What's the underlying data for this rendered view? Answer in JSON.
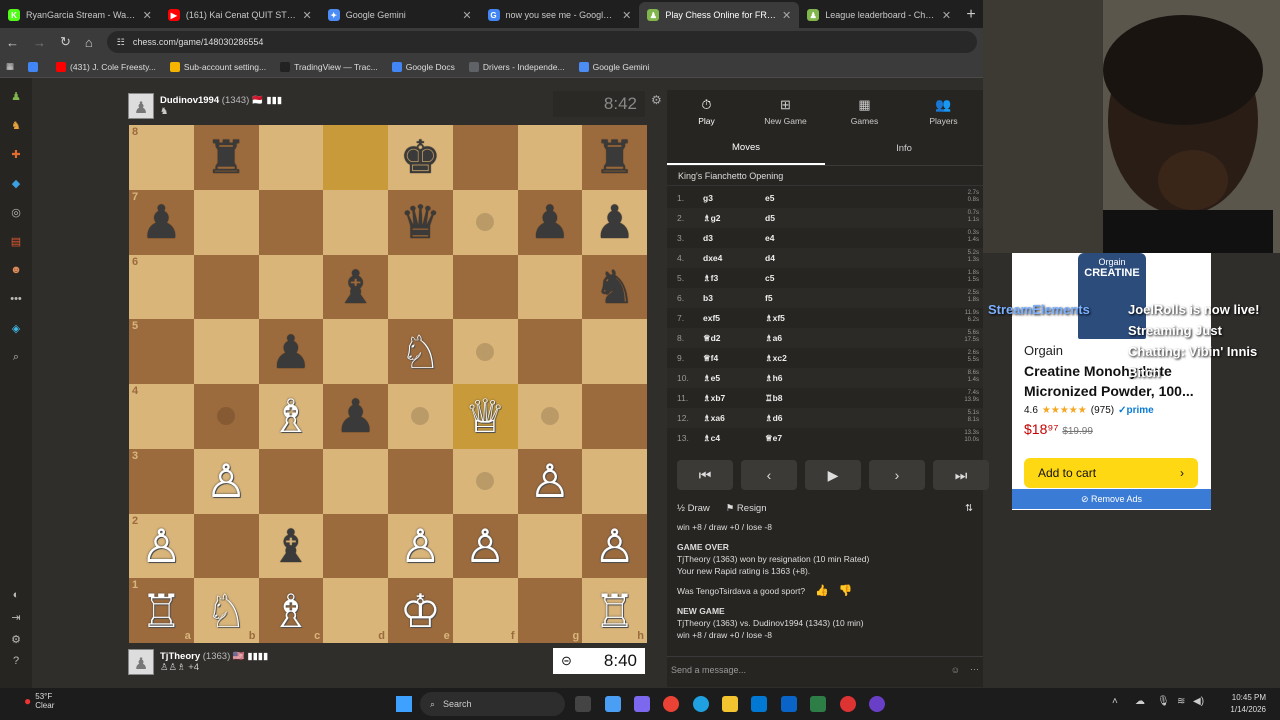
{
  "browser": {
    "tabs": [
      {
        "title": "RyanGarcia Stream - Watch Live",
        "color": "#53fc18",
        "glyph": "K"
      },
      {
        "title": "(161) Kai Cenat QUIT STREAMING",
        "color": "#ff0000",
        "glyph": "▶"
      },
      {
        "title": "Google Gemini",
        "color": "#4b8cf5",
        "glyph": "✦"
      },
      {
        "title": "now you see me - Google Search",
        "color": "#4285f4",
        "glyph": "G"
      },
      {
        "title": "Play Chess Online for FREE - 2 P",
        "color": "#81b64c",
        "glyph": "♟",
        "active": true
      },
      {
        "title": "League leaderboard - Chess.com",
        "color": "#81b64c",
        "glyph": "♟"
      }
    ],
    "url": "chess.com/game/148030286554",
    "bookmarks": [
      {
        "label": "",
        "color": "#4285f4"
      },
      {
        "label": "(431) J. Cole Freesty...",
        "color": "#ff0000"
      },
      {
        "label": "Sub-account setting...",
        "color": "#f4b400"
      },
      {
        "label": "TradingView — Trac...",
        "color": "#222222"
      },
      {
        "label": "Google Docs",
        "color": "#4285f4"
      },
      {
        "label": "Drivers - Independe...",
        "color": "#5f6368"
      },
      {
        "label": "Google Gemini",
        "color": "#4b8cf5"
      }
    ]
  },
  "game": {
    "top_player": {
      "name": "Dudinov1994",
      "rating": "(1343)",
      "flag": "🇲🇨 ▮▮▮",
      "clock": "8:42"
    },
    "bottom_player": {
      "name": "TjTheory",
      "rating": "(1363)",
      "flag": "🇺🇸 ▮▮▮▮",
      "captured": "♙♙♗ +4",
      "clock": "8:40"
    },
    "board": [
      [
        "",
        "♜",
        "",
        "",
        "♚",
        "",
        "",
        "♜"
      ],
      [
        "♟",
        "",
        "",
        "",
        "♛",
        "",
        "♟",
        "♟"
      ],
      [
        "",
        "",
        "",
        "♝",
        "",
        "",
        "",
        "♞"
      ],
      [
        "",
        "",
        "♟",
        "",
        "♘",
        "",
        "",
        ""
      ],
      [
        "",
        "",
        "♗",
        "♟",
        "",
        "♕",
        "",
        ""
      ],
      [
        "",
        "♙",
        "",
        "",
        "",
        "",
        "♙",
        ""
      ],
      [
        "♙",
        "",
        "♝",
        "",
        "♙",
        "♙",
        "",
        "♙"
      ],
      [
        "♖",
        "♘",
        "♗",
        "",
        "♔",
        "",
        "",
        "♖"
      ]
    ],
    "ranks": [
      "8",
      "7",
      "6",
      "5",
      "4",
      "3",
      "2",
      "1"
    ],
    "files": [
      "a",
      "b",
      "c",
      "d",
      "e",
      "f",
      "g",
      "h"
    ]
  },
  "panel": {
    "tabs": [
      {
        "label": "Play",
        "icon": "⏱"
      },
      {
        "label": "New Game",
        "icon": "⊞"
      },
      {
        "label": "Games",
        "icon": "▦"
      },
      {
        "label": "Players",
        "icon": "👥"
      }
    ],
    "subtabs": [
      "Moves",
      "Info"
    ],
    "opening": "King's Fianchetto Opening",
    "moves": [
      {
        "n": "1.",
        "w": "g3",
        "b": "e5",
        "t": "2.7s\n0.8s"
      },
      {
        "n": "2.",
        "w": "♗g2",
        "b": "d5",
        "t": "0.7s\n1.1s"
      },
      {
        "n": "3.",
        "w": "d3",
        "b": "e4",
        "t": "0.3s\n1.4s"
      },
      {
        "n": "4.",
        "w": "dxe4",
        "b": "d4",
        "t": "5.2s\n1.3s"
      },
      {
        "n": "5.",
        "w": "♗f3",
        "b": "c5",
        "t": "1.8s\n1.5s"
      },
      {
        "n": "6.",
        "w": "b3",
        "b": "f5",
        "t": "2.5s\n1.8s"
      },
      {
        "n": "7.",
        "w": "exf5",
        "b": "♗xf5",
        "t": "11.9s\n6.2s"
      },
      {
        "n": "8.",
        "w": "♕d2",
        "b": "♗a6",
        "t": "5.6s\n17.5s"
      },
      {
        "n": "9.",
        "w": "♕f4",
        "b": "♗xc2",
        "t": "2.6s\n5.5s"
      },
      {
        "n": "10.",
        "w": "♗e5",
        "b": "♗h6",
        "t": "8.6s\n1.4s"
      },
      {
        "n": "11.",
        "w": "♗xb7",
        "b": "♖b8",
        "t": "7.4s\n13.9s"
      },
      {
        "n": "12.",
        "w": "♗xa6",
        "b": "♗d6",
        "t": "5.1s\n8.1s"
      },
      {
        "n": "13.",
        "w": "♗c4",
        "b": "♕e7",
        "t": "13.3s\n10.0s"
      }
    ],
    "nav": [
      "⏮",
      "‹",
      "▶",
      "›",
      "⏭"
    ],
    "draw_label": "Draw",
    "resign_label": "Resign",
    "chat": {
      "line0": "win +8 / draw +0 / lose -8",
      "over_header": "GAME OVER",
      "over_line1": "TjTheory (1363) won by resignation (10 min Rated)",
      "over_line2": "Your new Rapid rating is 1363 (+8).",
      "sport_q": "Was TengoTsirdava a good sport?",
      "new_header": "NEW GAME",
      "new_line1": "TjTheory (1363) vs. Dudinov1994 (1343) (10 min)",
      "new_line2": "win +8 / draw +0 / lose -8"
    },
    "message_placeholder": "Send a message..."
  },
  "ad": {
    "brand_label": "Orgain",
    "product_label": "CREATINE",
    "title": "Creatine Monohydrate Micronized Powder, 100...",
    "rating": "4.6",
    "stars": "★★★★★",
    "reviews": "(975)",
    "prime": "✓prime",
    "price": "$18⁹⁷",
    "old_price": "$19.99",
    "cta": "Add to cart",
    "remove": "⊘ Remove Ads"
  },
  "stream_overlay": {
    "source": "StreamElements",
    "text": "JoelRolls is now live! Streaming Just Chatting: Vibin' Innis Bitch"
  },
  "taskbar": {
    "temp": "53°F",
    "weather": "Clear",
    "search": "Search",
    "time": "10:45 PM",
    "date": "1/14/2026"
  }
}
